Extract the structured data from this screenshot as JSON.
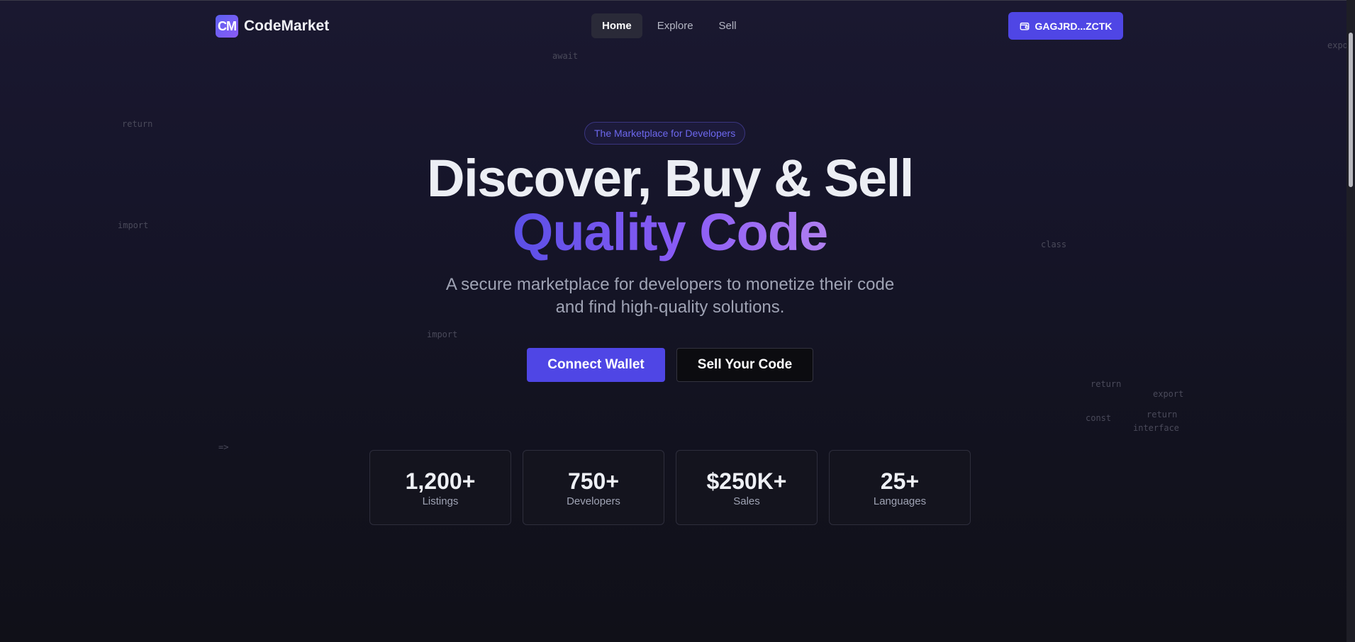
{
  "background_words": [
    "await",
    "return",
    "import",
    "class",
    "import",
    "return",
    "export",
    "const",
    "return",
    "interface",
    "=>",
    "expo"
  ],
  "brand": {
    "logo_mark": "CM",
    "name": "CodeMarket",
    "accent_color": "#4f46e5"
  },
  "nav": {
    "items": [
      {
        "label": "Home",
        "active": true
      },
      {
        "label": "Explore",
        "active": false
      },
      {
        "label": "Sell",
        "active": false
      }
    ]
  },
  "wallet": {
    "address": "GAGJRD...ZCTK",
    "icon": "wallet-icon"
  },
  "hero": {
    "badge": "The Marketplace for Developers",
    "title_line1": "Discover, Buy & Sell",
    "title_line2": "Quality Code",
    "subtitle": "A secure marketplace for developers to monetize their code and find high-quality solutions.",
    "primary_cta": "Connect Wallet",
    "secondary_cta": "Sell Your Code"
  },
  "stats": [
    {
      "value": "1,200+",
      "label": "Listings"
    },
    {
      "value": "750+",
      "label": "Developers"
    },
    {
      "value": "$250K+",
      "label": "Sales"
    },
    {
      "value": "25+",
      "label": "Languages"
    }
  ]
}
